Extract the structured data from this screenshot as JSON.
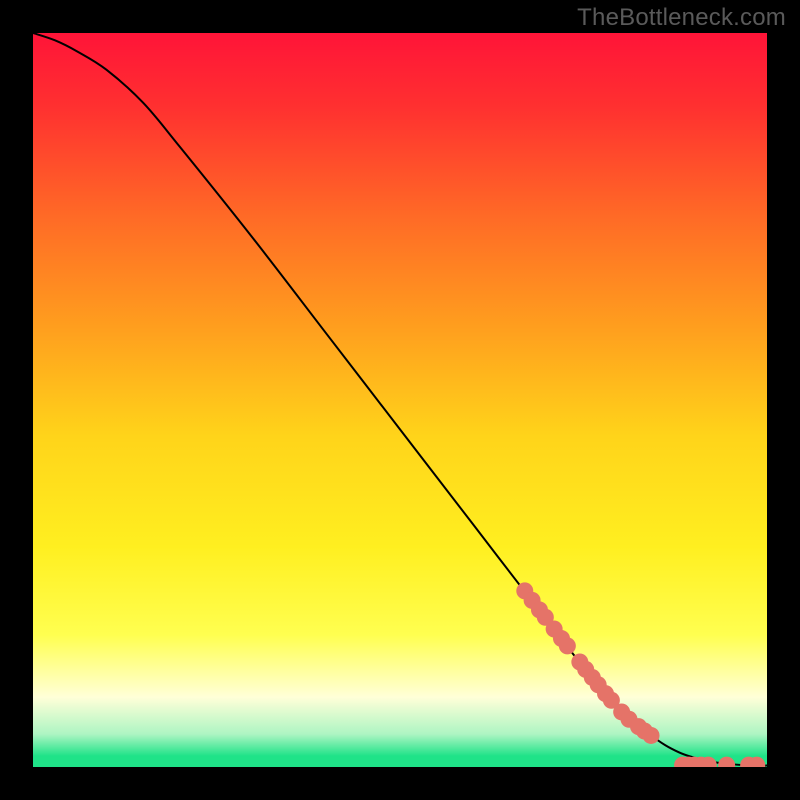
{
  "watermark": "TheBottleneck.com",
  "chart_data": {
    "type": "line",
    "title": "",
    "xlabel": "",
    "ylabel": "",
    "xlim": [
      0,
      100
    ],
    "ylim": [
      0,
      100
    ],
    "grid": false,
    "background": {
      "top_color": "#ff1a3a",
      "mid_color": "#ffe31a",
      "pale_band": "#ffffc8",
      "green_band": "#1fe388",
      "gradient_stops": [
        {
          "offset": 0.0,
          "color": "#ff1438"
        },
        {
          "offset": 0.1,
          "color": "#ff3030"
        },
        {
          "offset": 0.25,
          "color": "#ff6a26"
        },
        {
          "offset": 0.4,
          "color": "#ff9e1e"
        },
        {
          "offset": 0.55,
          "color": "#ffd41a"
        },
        {
          "offset": 0.7,
          "color": "#ffef20"
        },
        {
          "offset": 0.82,
          "color": "#ffff50"
        },
        {
          "offset": 0.905,
          "color": "#ffffd8"
        },
        {
          "offset": 0.955,
          "color": "#aef5c3"
        },
        {
          "offset": 0.985,
          "color": "#1fe388"
        }
      ]
    },
    "curve": {
      "description": "Monotone decreasing curve from top-left to bottom-right, slight convex shoulder near the top, nearly linear mid-section, flattening to y≈0 at the right edge.",
      "x": [
        0,
        3,
        6,
        10,
        15,
        20,
        30,
        40,
        50,
        60,
        70,
        78,
        84,
        88,
        92,
        95,
        98,
        100
      ],
      "y": [
        100,
        99,
        97.5,
        95,
        90.5,
        84.5,
        72,
        59,
        46,
        33,
        20,
        10,
        4.5,
        2,
        0.8,
        0.4,
        0.2,
        0.2
      ]
    },
    "markers": {
      "description": "Salmon circular markers clustered along the lower-right tail of the curve.",
      "color": "#e57368",
      "radius": 8.5,
      "points": [
        {
          "x": 67,
          "y": 24.0
        },
        {
          "x": 68,
          "y": 22.7
        },
        {
          "x": 69,
          "y": 21.4
        },
        {
          "x": 69.8,
          "y": 20.4
        },
        {
          "x": 71,
          "y": 18.8
        },
        {
          "x": 72,
          "y": 17.5
        },
        {
          "x": 72.8,
          "y": 16.5
        },
        {
          "x": 74.5,
          "y": 14.3
        },
        {
          "x": 75.3,
          "y": 13.3
        },
        {
          "x": 76.2,
          "y": 12.2
        },
        {
          "x": 77,
          "y": 11.2
        },
        {
          "x": 78,
          "y": 10.0
        },
        {
          "x": 78.8,
          "y": 9.1
        },
        {
          "x": 80.2,
          "y": 7.5
        },
        {
          "x": 81.2,
          "y": 6.5
        },
        {
          "x": 82.5,
          "y": 5.5
        },
        {
          "x": 83.3,
          "y": 4.9
        },
        {
          "x": 84.2,
          "y": 4.3
        },
        {
          "x": 88.5,
          "y": 0.25
        },
        {
          "x": 89.3,
          "y": 0.25
        },
        {
          "x": 90.1,
          "y": 0.25
        },
        {
          "x": 91.0,
          "y": 0.25
        },
        {
          "x": 92.0,
          "y": 0.25
        },
        {
          "x": 94.5,
          "y": 0.25
        },
        {
          "x": 97.5,
          "y": 0.25
        },
        {
          "x": 98.6,
          "y": 0.25
        }
      ]
    }
  }
}
